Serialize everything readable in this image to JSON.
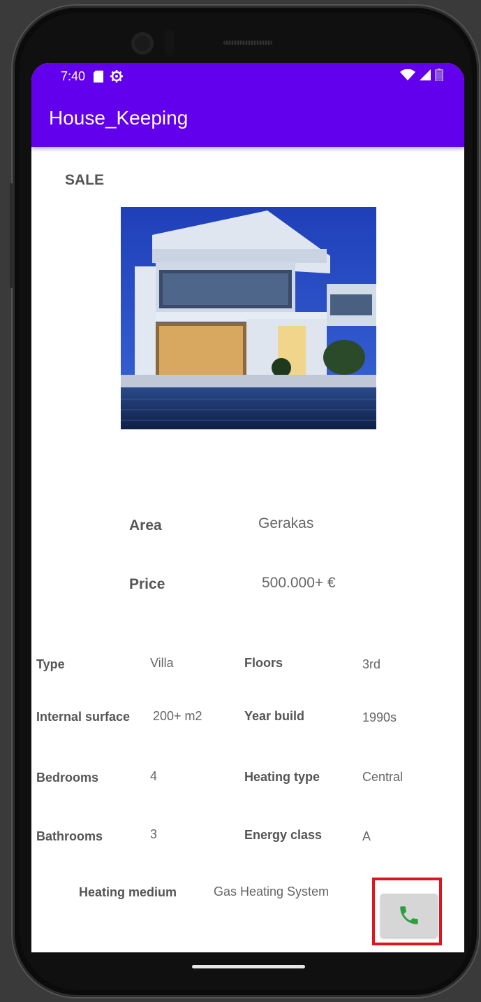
{
  "status_bar": {
    "time": "7:40",
    "icons_left": [
      "sd-card-icon",
      "settings-gear-icon"
    ],
    "icons_right": [
      "wifi-icon",
      "signal-icon",
      "battery-icon"
    ]
  },
  "app_bar": {
    "title": "House_Keeping"
  },
  "listing": {
    "badge": "SALE",
    "image_alt": "house-photo",
    "area_label": "Area",
    "area_value": "Gerakas",
    "price_label": "Price",
    "price_value": "500.000+ €"
  },
  "details": {
    "type_label": "Type",
    "type_value": "Villa",
    "floors_label": "Floors",
    "floors_value": "3rd",
    "surface_label": "Internal surface",
    "surface_value": "200+ m2",
    "year_label": "Year build",
    "year_value": "1990s",
    "bedrooms_label": "Bedrooms",
    "bedrooms_value": "4",
    "heating_type_label": "Heating type",
    "heating_type_value": "Central",
    "bathrooms_label": "Bathrooms",
    "bathrooms_value": "3",
    "energy_label": "Energy class",
    "energy_value": "A",
    "heating_medium_label": "Heating medium",
    "heating_medium_value": "Gas Heating System"
  },
  "call_button": {
    "icon": "phone-icon",
    "icon_color": "#2e9e44"
  },
  "colors": {
    "primary": "#6200ee",
    "highlight": "#e0141c"
  }
}
